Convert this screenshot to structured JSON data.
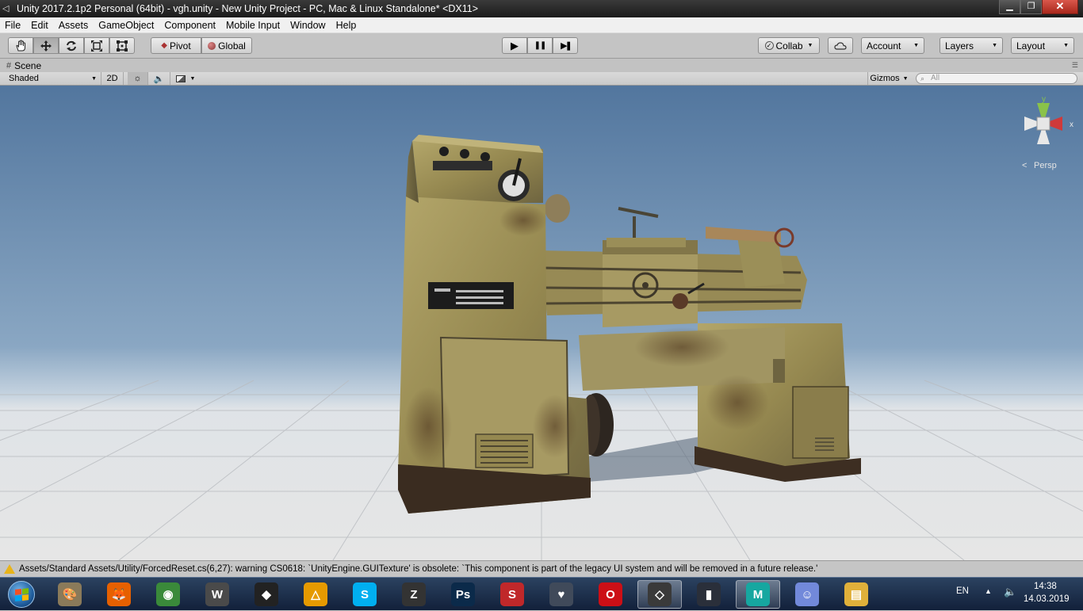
{
  "window": {
    "title": "Unity 2017.2.1p2 Personal (64bit) - vgh.unity - New Unity Project - PC, Mac & Linux Standalone* <DX11>",
    "minimize_glyph": "▁",
    "maximize_glyph": "❐",
    "close_glyph": "✕"
  },
  "menu": [
    "File",
    "Edit",
    "Assets",
    "GameObject",
    "Component",
    "Mobile Input",
    "Window",
    "Help"
  ],
  "toolbar": {
    "tools": [
      "hand-icon",
      "move-icon",
      "rotate-icon",
      "scale-icon",
      "rect-icon"
    ],
    "pivot_label": "Pivot",
    "global_label": "Global",
    "play_glyph": "▶",
    "pause_glyph": "❚❚",
    "step_glyph": "▶❚",
    "collab_label": "Collab",
    "account_label": "Account",
    "layers_label": "Layers",
    "layout_label": "Layout"
  },
  "scene": {
    "tab_label": "Scene",
    "shading_mode": "Shaded",
    "mode_2d": "2D",
    "gizmos_label": "Gizmos",
    "search_placeholder": "All",
    "perspective_label": "Persp",
    "gizmo_y": "y",
    "gizmo_x": "x"
  },
  "status": {
    "message": "Assets/Standard Assets/Utility/ForcedReset.cs(6,27): warning CS0618: `UnityEngine.GUITexture' is obsolete: `This component is part of the legacy UI system and will be removed in a future release.'",
    "level": "warning"
  },
  "taskbar": {
    "apps": [
      {
        "name": "paint",
        "glyph": "🎨",
        "color": "#8a7a5a"
      },
      {
        "name": "firefox",
        "glyph": "🦊",
        "color": "#e66000"
      },
      {
        "name": "chrome",
        "glyph": "◉",
        "color": "#3a8a3a"
      },
      {
        "name": "world-of-tanks",
        "glyph": "W",
        "color": "#4a4a4a"
      },
      {
        "name": "epic-games",
        "glyph": "◆",
        "color": "#222222"
      },
      {
        "name": "arkane",
        "glyph": "△",
        "color": "#e69a00"
      },
      {
        "name": "skype",
        "glyph": "S",
        "color": "#00aff0"
      },
      {
        "name": "zbrush",
        "glyph": "Z",
        "color": "#333333"
      },
      {
        "name": "photoshop",
        "glyph": "Ps",
        "color": "#0b2a4a"
      },
      {
        "name": "substance",
        "glyph": "S",
        "color": "#c0282a"
      },
      {
        "name": "app-heart",
        "glyph": "♥",
        "color": "#404a5a"
      },
      {
        "name": "opera",
        "glyph": "O",
        "color": "#cc0f16"
      },
      {
        "name": "unity",
        "glyph": "◇",
        "color": "#3a3a3a"
      },
      {
        "name": "equalizer",
        "glyph": "▮",
        "color": "#2a2f3a"
      },
      {
        "name": "maya",
        "glyph": "M",
        "color": "#16a7a0"
      },
      {
        "name": "discord",
        "glyph": "☺",
        "color": "#7289da"
      },
      {
        "name": "file-explorer",
        "glyph": "▤",
        "color": "#e0b03a"
      }
    ],
    "language": "EN",
    "time": "14:38",
    "date": "14.03.2019"
  }
}
